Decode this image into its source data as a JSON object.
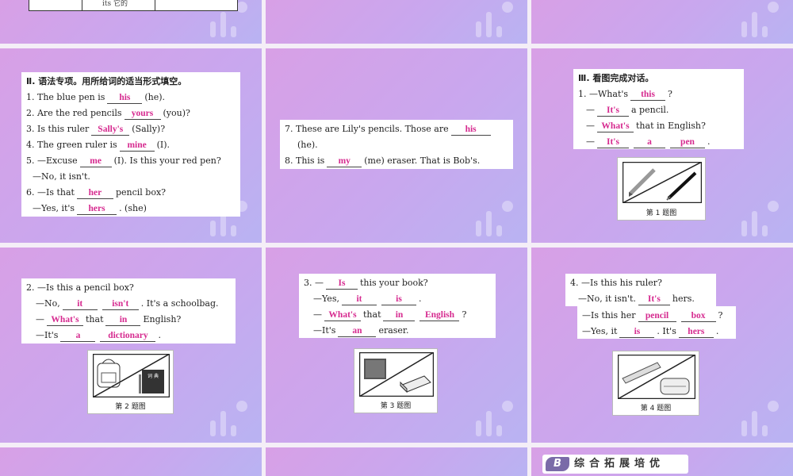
{
  "top_fragment": {
    "text": "its 它的"
  },
  "section2": {
    "title": "Ⅱ. 语法专项。用所给词的适当形式填空。",
    "q1": {
      "pre": "1. The blue pen is",
      "ans": "his",
      "post": "(he)."
    },
    "q2": {
      "pre": "2. Are the red pencils",
      "ans": "yours",
      "post": "(you)?"
    },
    "q3": {
      "pre": "3. Is this ruler",
      "ans": "Sally's",
      "post": "(Sally)?"
    },
    "q4": {
      "pre": "4. The green ruler is",
      "ans": "mine",
      "post": "(I)."
    },
    "q5": {
      "pre": "5. —Excuse",
      "ans": "me",
      "post": "(I). Is this your red pen?",
      "line2": "—No, it isn't."
    },
    "q6": {
      "pre": "6. —Is that",
      "ans": "her",
      "post": "pencil box?",
      "l2pre": "—Yes, it's",
      "l2ans": "hers",
      "l2post": ". (she)"
    },
    "q7": {
      "pre": "7. These are Lily's pencils. Those are",
      "ans": "his",
      "line2": "(he)."
    },
    "q8": {
      "pre": "8. This is",
      "ans": "my",
      "post": "(me) eraser. That is Bob's."
    }
  },
  "section3": {
    "title": "Ⅲ. 看图完成对话。",
    "d1": {
      "l1pre": "1. —What's",
      "l1ans": "this",
      "l1post": "?",
      "l2pre": "—",
      "l2ans": "It's",
      "l2post": "a pencil.",
      "l3pre": "—",
      "l3ans": "What's",
      "l3post": "that in English?",
      "l4pre": "—",
      "l4a": "It's",
      "l4b": "a",
      "l4c": "pen",
      "l4post": ".",
      "caption": "第 1 题图"
    },
    "d2": {
      "l1": "2. —Is this a pencil box?",
      "l2pre": "—No,",
      "l2a": "it",
      "l2b": "isn't",
      "l2post": ". It's a schoolbag.",
      "l3pre": "—",
      "l3a": "What's",
      "l3mid": "that",
      "l3b": "in",
      "l3post": "English?",
      "l4pre": "—It's",
      "l4a": "a",
      "l4b": "dictionary",
      "l4post": ".",
      "caption": "第 2 题图",
      "book_label": "词 典"
    },
    "d3": {
      "l1pre": "3. —",
      "l1ans": "Is",
      "l1post": "this your book?",
      "l2pre": "—Yes,",
      "l2a": "it",
      "l2b": "is",
      "l2post": ".",
      "l3pre": "—",
      "l3a": "What's",
      "l3mid": "that",
      "l3b": "in",
      "l3c": "English",
      "l3post": "?",
      "l4pre": "—It's",
      "l4ans": "an",
      "l4post": "eraser.",
      "caption": "第 3 题图"
    },
    "d4": {
      "l1": "4. —Is this his ruler?",
      "l2pre": "—No, it isn't.",
      "l2ans": "It's",
      "l2post": "hers.",
      "l3pre": "—Is this her",
      "l3a": "pencil",
      "l3b": "box",
      "l3post": "?",
      "l4pre": "—Yes, it",
      "l4ans": "is",
      "l4mid": ". It's",
      "l4b": "hers",
      "l4post": ".",
      "caption": "第 4 题图"
    }
  },
  "sectionB": {
    "badge": "B",
    "title": "综合拓展培优"
  },
  "colors": {
    "answer": "#d62a8f",
    "slide_from": "#d8a0e6",
    "slide_to": "#b9b3f2"
  }
}
